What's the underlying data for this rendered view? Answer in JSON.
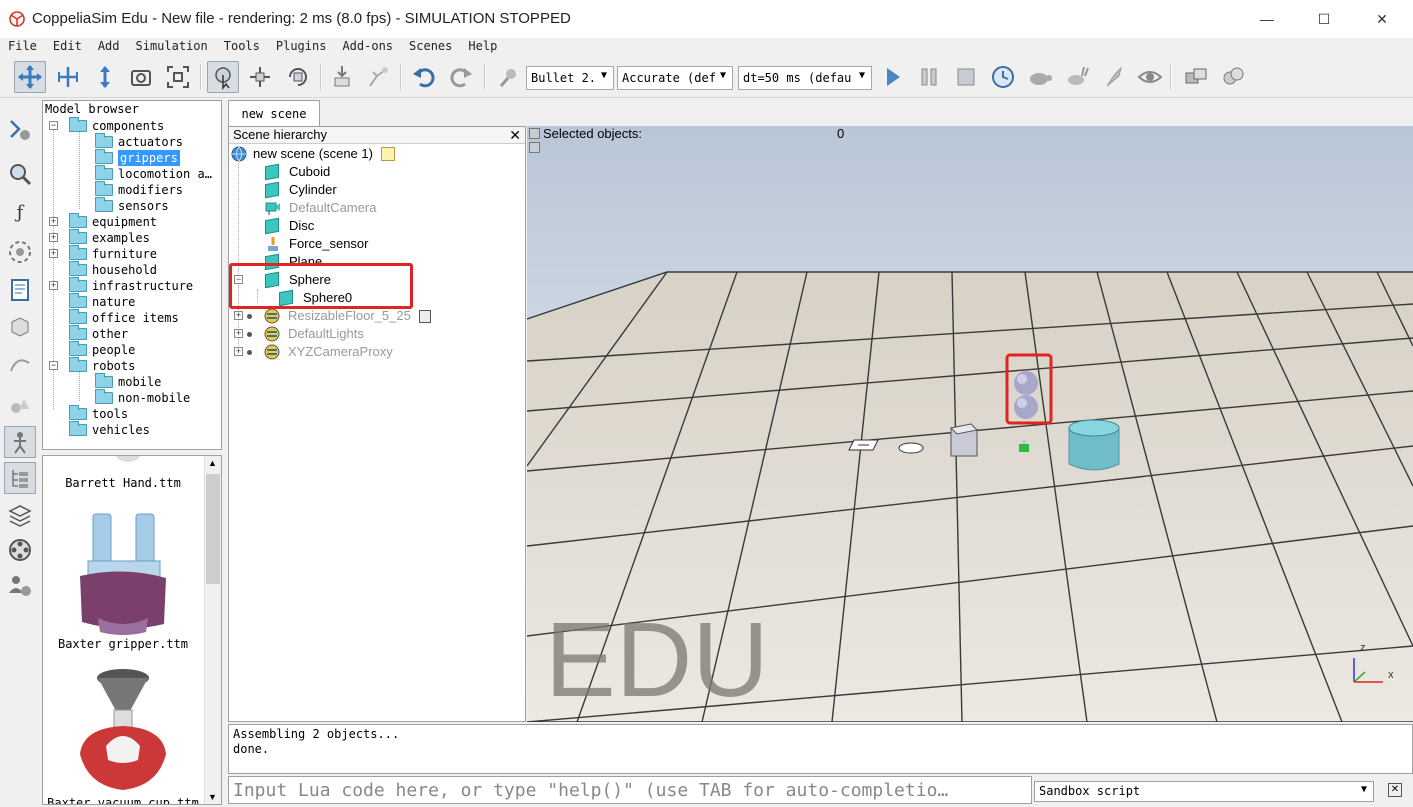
{
  "window": {
    "title": "CoppeliaSim Edu - New file - rendering: 2 ms (8.0 fps) - SIMULATION STOPPED",
    "minimize_glyph": "—",
    "maximize_glyph": "☐",
    "close_glyph": "✕"
  },
  "menu": [
    "File",
    "Edit",
    "Add",
    "Simulation",
    "Tools",
    "Plugins",
    "Add-ons",
    "Scenes",
    "Help"
  ],
  "toolbar": {
    "engine": "Bullet 2.",
    "accuracy": "Accurate (def",
    "timestep": "dt=50 ms (defau",
    "icons": [
      "camera-pan-icon",
      "camera-rotate-icon",
      "camera-shift-icon",
      "camera-angle-icon",
      "fit-to-view-icon",
      "click-select-icon",
      "object-shift-icon",
      "object-rotate-icon",
      "assemble-icon",
      "transfer-dna-icon",
      "undo-icon",
      "redo-icon",
      "physics-engine-icon",
      "start-simulation-icon",
      "pause-simulation-icon",
      "stop-simulation-icon",
      "real-time-icon",
      "slow-down-icon",
      "speed-up-icon",
      "threaded-rendering-icon",
      "visualization-icon",
      "page-selector-icon",
      "scene-selector-icon"
    ]
  },
  "model_browser": {
    "title": "Model browser",
    "items": [
      {
        "label": "components",
        "expanded": true
      },
      {
        "label": "actuators"
      },
      {
        "label": "grippers",
        "selected": true
      },
      {
        "label": "locomotion a…"
      },
      {
        "label": "modifiers"
      },
      {
        "label": "sensors"
      },
      {
        "label": "equipment"
      },
      {
        "label": "examples"
      },
      {
        "label": "furniture"
      },
      {
        "label": "household"
      },
      {
        "label": "infrastructure"
      },
      {
        "label": "nature"
      },
      {
        "label": "office items"
      },
      {
        "label": "other"
      },
      {
        "label": "people"
      },
      {
        "label": "robots",
        "expanded": true
      },
      {
        "label": "mobile"
      },
      {
        "label": "non-mobile"
      },
      {
        "label": "tools"
      },
      {
        "label": "vehicles"
      }
    ]
  },
  "thumbnails": [
    {
      "label": "Barrett Hand.ttm"
    },
    {
      "label": "Baxter gripper.ttm"
    },
    {
      "label": "Baxter vacuum cup.ttm"
    }
  ],
  "scene_tab": "new scene",
  "hierarchy": {
    "title": "Scene hierarchy",
    "close": "✕",
    "root": "new scene (scene 1)",
    "items": [
      {
        "label": "Cuboid"
      },
      {
        "label": "Cylinder"
      },
      {
        "label": "DefaultCamera",
        "dim": true
      },
      {
        "label": "Disc"
      },
      {
        "label": "Force_sensor"
      },
      {
        "label": "Plane"
      },
      {
        "label": "Sphere"
      },
      {
        "label": "Sphere0"
      },
      {
        "label": "ResizableFloor_5_25",
        "dim": true
      },
      {
        "label": "DefaultLights",
        "dim": true
      },
      {
        "label": "XYZCameraProxy",
        "dim": true
      }
    ]
  },
  "viewport": {
    "selected_label": "Selected objects:",
    "selected_count": "0",
    "watermark": "EDU",
    "axis_z": "z",
    "axis_x": "x"
  },
  "console": {
    "lines": [
      "Assembling 2 objects...",
      "done."
    ],
    "input_placeholder": "Input Lua code here, or type \"help()\" (use TAB for auto-completio…",
    "script_type": "Sandbox script",
    "close": "✕"
  },
  "colors": {
    "highlight": "#e02424",
    "selection": "#3399ff",
    "shape": "#3cc6c0"
  }
}
